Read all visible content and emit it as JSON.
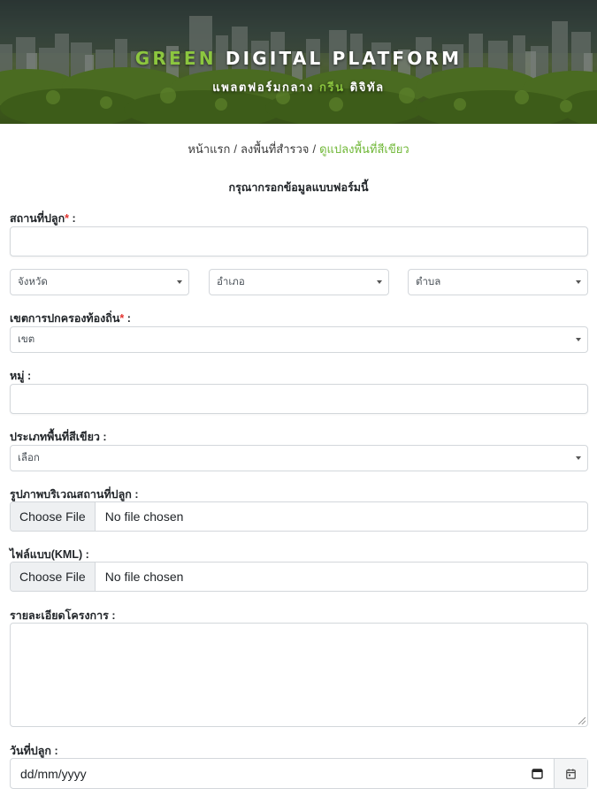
{
  "header": {
    "title_green": "GREEN",
    "title_rest": "DIGITAL PLATFORM",
    "subtitle_pre": "แพลตฟอร์มกลาง",
    "subtitle_green": "กรีน",
    "subtitle_post": "ดิจิทัล",
    "accent_color": "#8cc63f"
  },
  "breadcrumb": {
    "home": "หน้าแรก",
    "survey": "ลงพื้นที่สำรวจ",
    "current": "ดูแปลงพื้นที่สีเขียว",
    "separator": "/"
  },
  "form": {
    "heading": "กรุณากรอกข้อมูลแบบฟอร์มนี้",
    "location": {
      "label": "สถานที่ปลูก",
      "required": "*",
      "suffix": " :",
      "value": ""
    },
    "province": {
      "selected": "จังหวัด"
    },
    "district": {
      "selected": "อำเภอ"
    },
    "subdistrict": {
      "selected": "ตำบล"
    },
    "local_admin": {
      "label": "เขตการปกครองท้องถิ่น",
      "required": "*",
      "suffix": " :",
      "selected": "เขต"
    },
    "village": {
      "label": "หมู่ :",
      "value": ""
    },
    "green_type": {
      "label": "ประเภทพื้นที่สีเขียว :",
      "selected": "เลือก"
    },
    "photo": {
      "label": "รูปภาพบริเวณสถานที่ปลูก :",
      "button": "Choose File",
      "status": "No file chosen"
    },
    "kml": {
      "label": "ไฟล์แบบ(KML) :",
      "button": "Choose File",
      "status": "No file chosen"
    },
    "details": {
      "label": "รายละเอียดโครงการ :",
      "value": ""
    },
    "plant_date": {
      "label": "วันที่ปลูก :",
      "placeholder": "dd/mm/yyyy"
    }
  }
}
